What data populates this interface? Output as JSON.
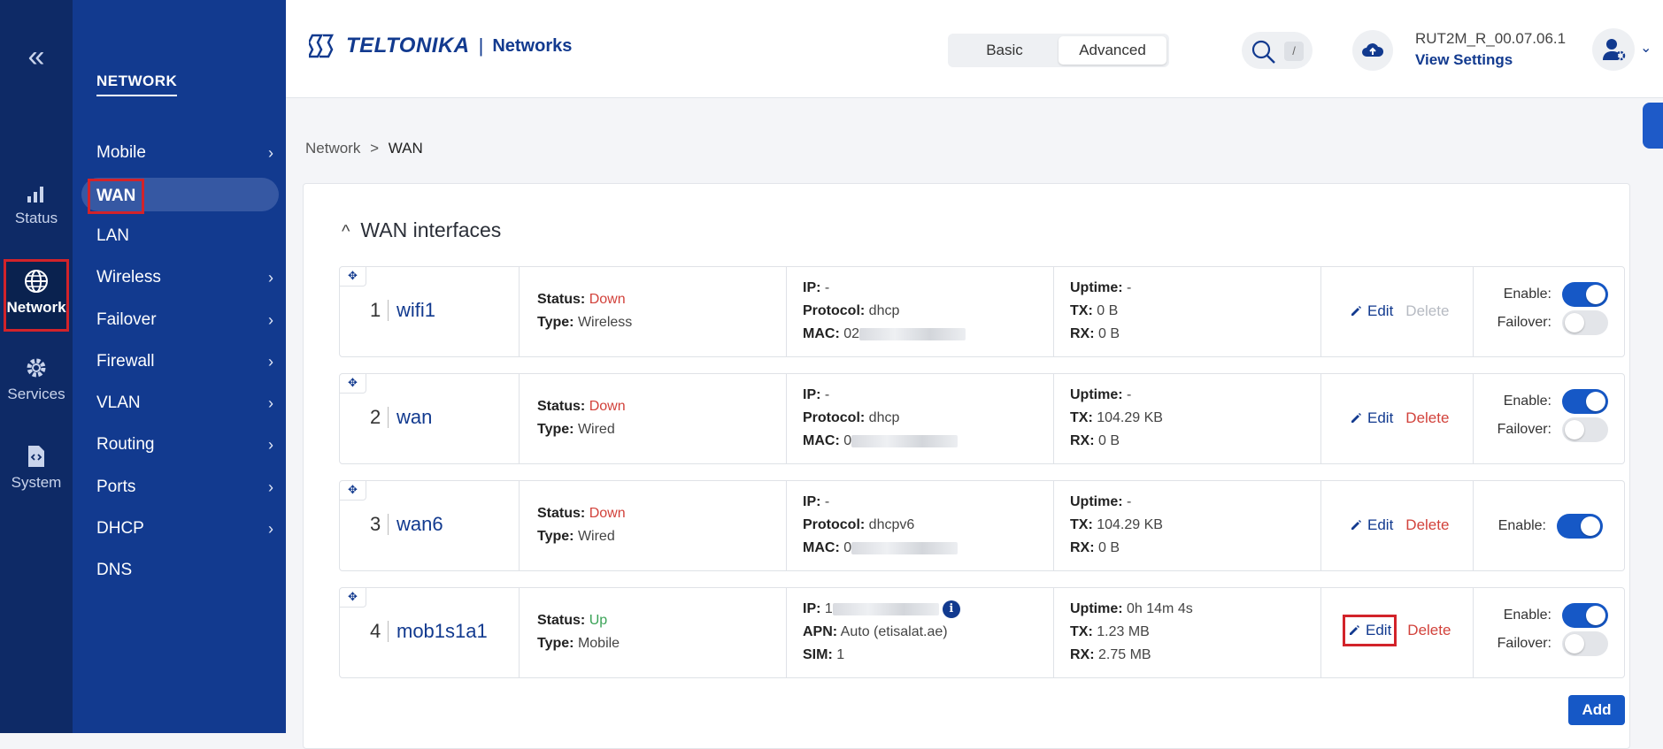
{
  "rail": {
    "collapse": "«",
    "items": [
      {
        "label": "Status"
      },
      {
        "label": "Network"
      },
      {
        "label": "Services"
      },
      {
        "label": "System"
      }
    ]
  },
  "nav": {
    "title": "NETWORK",
    "items": [
      {
        "label": "Mobile",
        "chevron": "›"
      },
      {
        "label": "WAN",
        "chevron": ""
      },
      {
        "label": "LAN",
        "chevron": ""
      },
      {
        "label": "Wireless",
        "chevron": "›"
      },
      {
        "label": "Failover",
        "chevron": "›"
      },
      {
        "label": "Firewall",
        "chevron": "›"
      },
      {
        "label": "VLAN",
        "chevron": "›"
      },
      {
        "label": "Routing",
        "chevron": "›"
      },
      {
        "label": "Ports",
        "chevron": "›"
      },
      {
        "label": "DHCP",
        "chevron": "›"
      },
      {
        "label": "DNS",
        "chevron": ""
      }
    ]
  },
  "header": {
    "brand": "TELTONIKA",
    "separator": "|",
    "sub": "Networks",
    "mode_basic": "Basic",
    "mode_advanced": "Advanced",
    "search_shortcut": "/",
    "firmware": "RUT2M_R_00.07.06.1",
    "view_settings": "View Settings"
  },
  "breadcrumb": {
    "parent": "Network",
    "sep": ">",
    "current": "WAN"
  },
  "section": {
    "caret": "^",
    "title": "WAN interfaces"
  },
  "labels": {
    "status": "Status:",
    "type": "Type:",
    "ip": "IP:",
    "protocol": "Protocol:",
    "mac": "MAC:",
    "apn": "APN:",
    "sim": "SIM:",
    "uptime": "Uptime:",
    "tx": "TX:",
    "rx": "RX:",
    "edit": "Edit",
    "delete": "Delete",
    "enable": "Enable:",
    "failover": "Failover:",
    "info": "i"
  },
  "rows": [
    {
      "index": "1",
      "name": "wifi1",
      "status": "Down",
      "type": "Wireless",
      "ip": "-",
      "protocol": "dhcp",
      "mac": "02",
      "uptime": "-",
      "tx": "0 B",
      "rx": "0 B",
      "enable": true,
      "failover": false
    },
    {
      "index": "2",
      "name": "wan",
      "status": "Down",
      "type": "Wired",
      "ip": "-",
      "protocol": "dhcp",
      "mac": "0",
      "uptime": "-",
      "tx": "104.29 KB",
      "rx": "0 B",
      "enable": true,
      "failover": false
    },
    {
      "index": "3",
      "name": "wan6",
      "status": "Down",
      "type": "Wired",
      "ip": "-",
      "protocol": "dhcpv6",
      "mac": "0",
      "uptime": "-",
      "tx": "104.29 KB",
      "rx": "0 B",
      "enable": true
    },
    {
      "index": "4",
      "name": "mob1s1a1",
      "status": "Up",
      "type": "Mobile",
      "ip": "1",
      "apn": "Auto (etisalat.ae)",
      "sim": "1",
      "uptime": "0h 14m 4s",
      "tx": "1.23 MB",
      "rx": "2.75 MB",
      "enable": true,
      "failover": false
    }
  ],
  "add_label": "Add",
  "colors": {
    "rail": "#0e2a66",
    "nav": "#123a8f",
    "accent": "#1658c6",
    "down": "#d2423b",
    "up": "#3aa357",
    "highlight": "#d2232a"
  }
}
